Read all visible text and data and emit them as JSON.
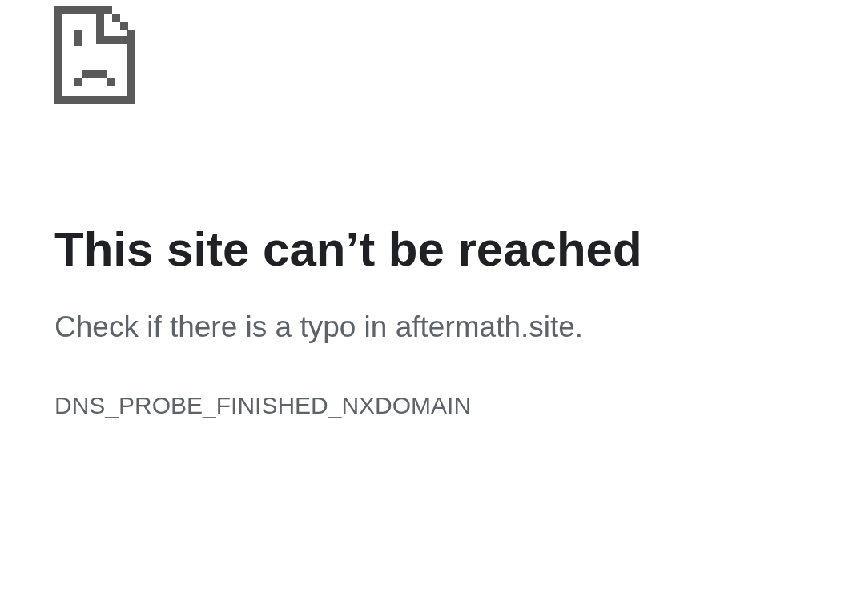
{
  "heading": "This site can’t be reached",
  "message": "Check if there is a typo in aftermath.site.",
  "error_code": "DNS_PROBE_FINISHED_NXDOMAIN"
}
